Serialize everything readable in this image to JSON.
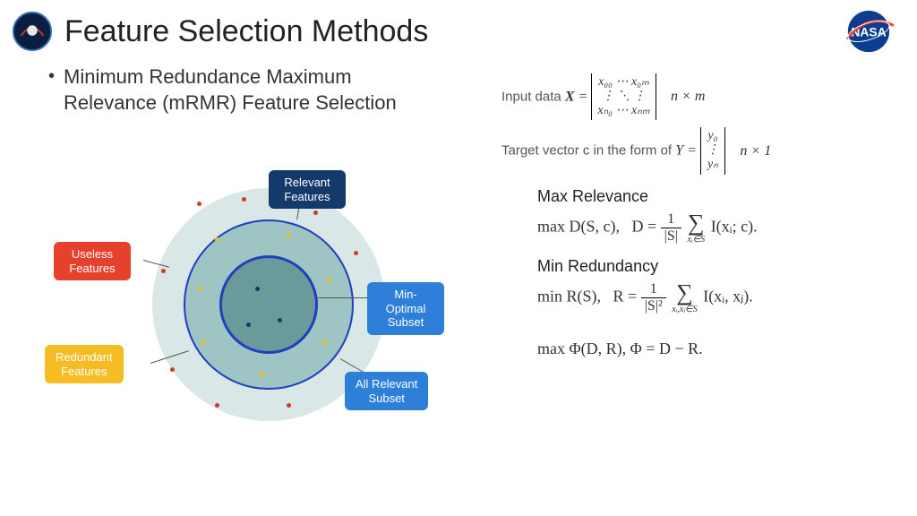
{
  "title": "Feature Selection Methods",
  "bullet": "Minimum Redundance Maximum Relevance (mRMR) Feature Selection",
  "diagram": {
    "relevant": "Relevant\nFeatures",
    "useless": "Useless\nFeatures",
    "redundant": "Redundant\nFeatures",
    "minopt": "Min-Optimal\nSubset",
    "allrel": "All Relevant\nSubset"
  },
  "input": {
    "label": "Input data ",
    "var": "X",
    "matrix": {
      "r0": "x₀₀   ⋯   x₀ₘ",
      "r1": "⋮    ⋱    ⋮",
      "r2": "xₙ₀   ⋯   xₙₘ"
    },
    "dims": "n × m"
  },
  "target": {
    "label": "Target vector c in the form of ",
    "var": "Y",
    "vec": {
      "r0": "y₀",
      "r1": "⋮",
      "r2": "yₙ"
    },
    "dims": "n × 1"
  },
  "maxrel": {
    "head": "Max Relevance",
    "lhs": "max D(S, c),",
    "rhs_pre": "D = ",
    "frac_num": "1",
    "frac_den": "|S|",
    "sum_sub": "xᵢ∈S",
    "tail": "I(xᵢ; c)."
  },
  "minred": {
    "head": "Min Redundancy",
    "lhs": "min R(S),",
    "rhs_pre": "R = ",
    "frac_num": "1",
    "frac_den": "|S|²",
    "sum_sub": "xᵢ,xⱼ∈S",
    "tail": "I(xᵢ, xⱼ)."
  },
  "combined": "max Φ(D, R), Φ = D − R."
}
